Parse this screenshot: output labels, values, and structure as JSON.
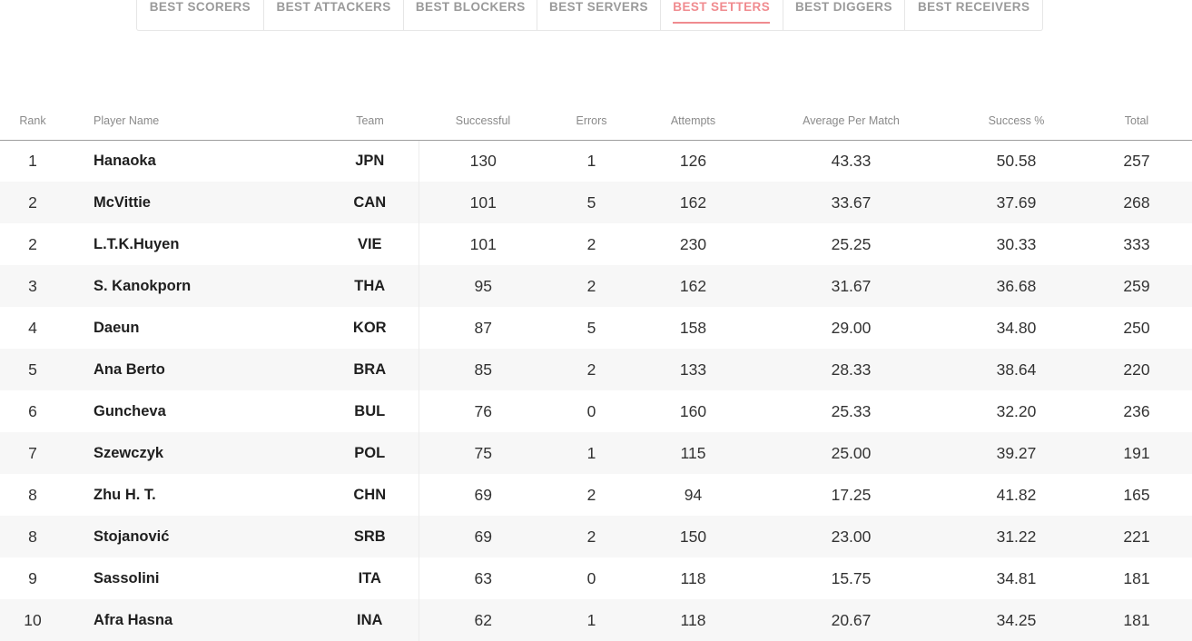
{
  "tabs": [
    {
      "label": "BEST SCORERS",
      "active": false
    },
    {
      "label": "BEST ATTACKERS",
      "active": false
    },
    {
      "label": "BEST BLOCKERS",
      "active": false
    },
    {
      "label": "BEST SERVERS",
      "active": false
    },
    {
      "label": "BEST SETTERS",
      "active": true
    },
    {
      "label": "BEST DIGGERS",
      "active": false
    },
    {
      "label": "BEST RECEIVERS",
      "active": false
    }
  ],
  "table": {
    "headers": {
      "rank": "Rank",
      "player": "Player Name",
      "team": "Team",
      "successful": "Successful",
      "errors": "Errors",
      "attempts": "Attempts",
      "average": "Average Per Match",
      "success_pct": "Success %",
      "total": "Total"
    },
    "rows": [
      {
        "rank": "1",
        "player": "Hanaoka",
        "team": "JPN",
        "successful": "130",
        "errors": "1",
        "attempts": "126",
        "average": "43.33",
        "success_pct": "50.58",
        "total": "257"
      },
      {
        "rank": "2",
        "player": "McVittie",
        "team": "CAN",
        "successful": "101",
        "errors": "5",
        "attempts": "162",
        "average": "33.67",
        "success_pct": "37.69",
        "total": "268"
      },
      {
        "rank": "2",
        "player": "L.T.K.Huyen",
        "team": "VIE",
        "successful": "101",
        "errors": "2",
        "attempts": "230",
        "average": "25.25",
        "success_pct": "30.33",
        "total": "333"
      },
      {
        "rank": "3",
        "player": "S. Kanokporn",
        "team": "THA",
        "successful": "95",
        "errors": "2",
        "attempts": "162",
        "average": "31.67",
        "success_pct": "36.68",
        "total": "259"
      },
      {
        "rank": "4",
        "player": "Daeun",
        "team": "KOR",
        "successful": "87",
        "errors": "5",
        "attempts": "158",
        "average": "29.00",
        "success_pct": "34.80",
        "total": "250"
      },
      {
        "rank": "5",
        "player": "Ana Berto",
        "team": "BRA",
        "successful": "85",
        "errors": "2",
        "attempts": "133",
        "average": "28.33",
        "success_pct": "38.64",
        "total": "220"
      },
      {
        "rank": "6",
        "player": "Guncheva",
        "team": "BUL",
        "successful": "76",
        "errors": "0",
        "attempts": "160",
        "average": "25.33",
        "success_pct": "32.20",
        "total": "236"
      },
      {
        "rank": "7",
        "player": "Szewczyk",
        "team": "POL",
        "successful": "75",
        "errors": "1",
        "attempts": "115",
        "average": "25.00",
        "success_pct": "39.27",
        "total": "191"
      },
      {
        "rank": "8",
        "player": "Zhu H. T.",
        "team": "CHN",
        "successful": "69",
        "errors": "2",
        "attempts": "94",
        "average": "17.25",
        "success_pct": "41.82",
        "total": "165"
      },
      {
        "rank": "8",
        "player": "Stojanović",
        "team": "SRB",
        "successful": "69",
        "errors": "2",
        "attempts": "150",
        "average": "23.00",
        "success_pct": "31.22",
        "total": "221"
      },
      {
        "rank": "9",
        "player": "Sassolini",
        "team": "ITA",
        "successful": "63",
        "errors": "0",
        "attempts": "118",
        "average": "15.75",
        "success_pct": "34.81",
        "total": "181"
      },
      {
        "rank": "10",
        "player": "Afra Hasna",
        "team": "INA",
        "successful": "62",
        "errors": "1",
        "attempts": "118",
        "average": "20.67",
        "success_pct": "34.25",
        "total": "181"
      }
    ]
  }
}
